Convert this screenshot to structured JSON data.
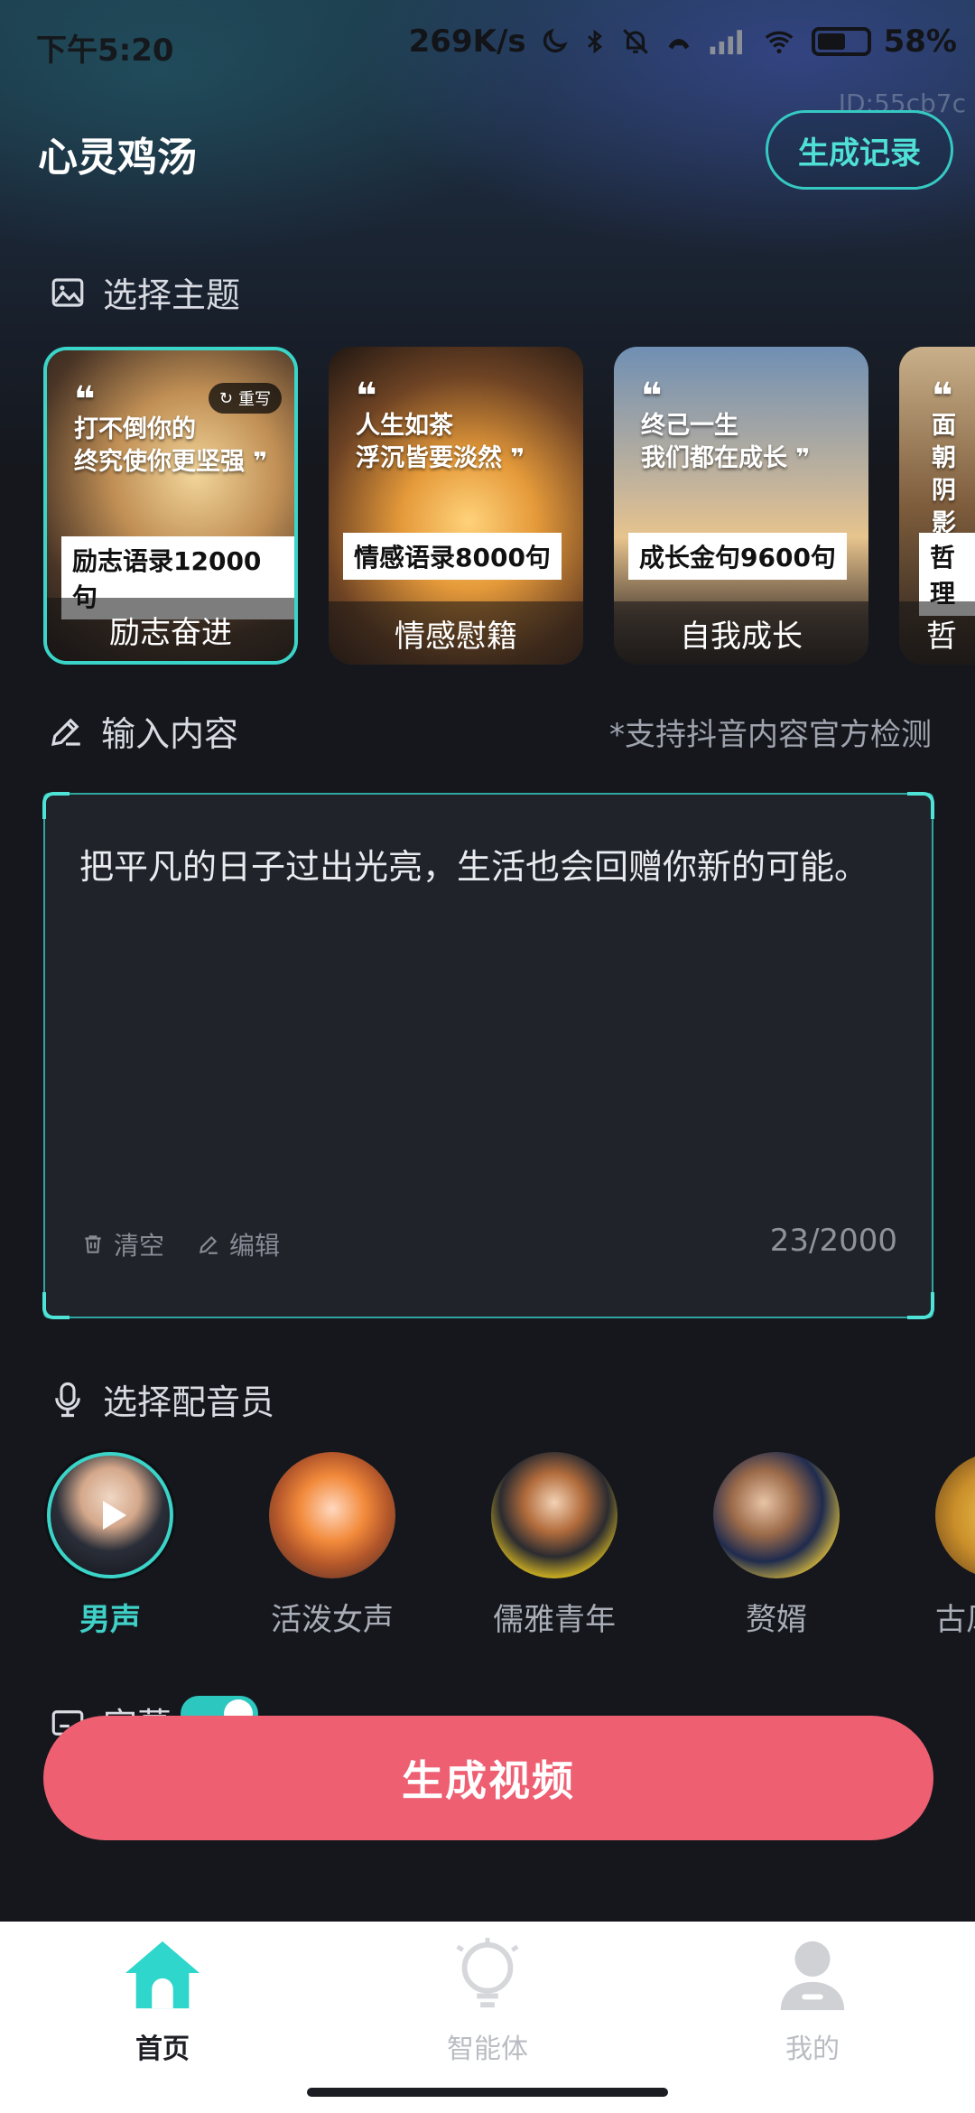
{
  "status_bar": {
    "time": "下午5:20",
    "speed": "269K/s",
    "battery": "58%"
  },
  "app": {
    "id_label": "ID:55cb7c",
    "title": "心灵鸡汤",
    "history_button": "生成记录"
  },
  "theme_section": {
    "title": "选择主题",
    "cards": [
      {
        "quote_line1": "打不倒你的",
        "quote_line2": "终究使你更坚强",
        "label": "励志语录12000句",
        "name": "励志奋进",
        "selected": true,
        "rewrite": "重写"
      },
      {
        "quote_line1": "人生如茶",
        "quote_line2": "浮沉皆要淡然",
        "label": "情感语录8000句",
        "name": "情感慰籍",
        "selected": false
      },
      {
        "quote_line1": "终己一生",
        "quote_line2": "我们都在成长",
        "label": "成长金句9600句",
        "name": "自我成长",
        "selected": false
      },
      {
        "quote_line1": "面朝",
        "quote_line2": "阴影",
        "label": "哲理",
        "name": "哲",
        "selected": false
      }
    ]
  },
  "input_section": {
    "title": "输入内容",
    "tip": "*支持抖音内容官方检测",
    "content": "把平凡的日子过出光亮，生活也会回赠你新的可能。",
    "clear_label": "清空",
    "edit_label": "编辑",
    "counter": "23/2000"
  },
  "voice_section": {
    "title": "选择配音员",
    "voices": [
      {
        "name": "男声",
        "selected": true
      },
      {
        "name": "活泼女声",
        "selected": false
      },
      {
        "name": "儒雅青年",
        "selected": false
      },
      {
        "name": "赘婿",
        "selected": false
      },
      {
        "name": "古风",
        "selected": false
      }
    ]
  },
  "subtitle_section": {
    "title": "字幕"
  },
  "generate_button": "生成视频",
  "bottom_nav": {
    "items": [
      {
        "label": "首页",
        "icon": "home-icon",
        "active": true
      },
      {
        "label": "智能体",
        "icon": "bulb-icon",
        "active": false
      },
      {
        "label": "我的",
        "icon": "profile-icon",
        "active": false
      }
    ]
  },
  "colors": {
    "accent": "#3ad4c9",
    "primary_button": "#ee5f72",
    "background": "#15171d"
  }
}
